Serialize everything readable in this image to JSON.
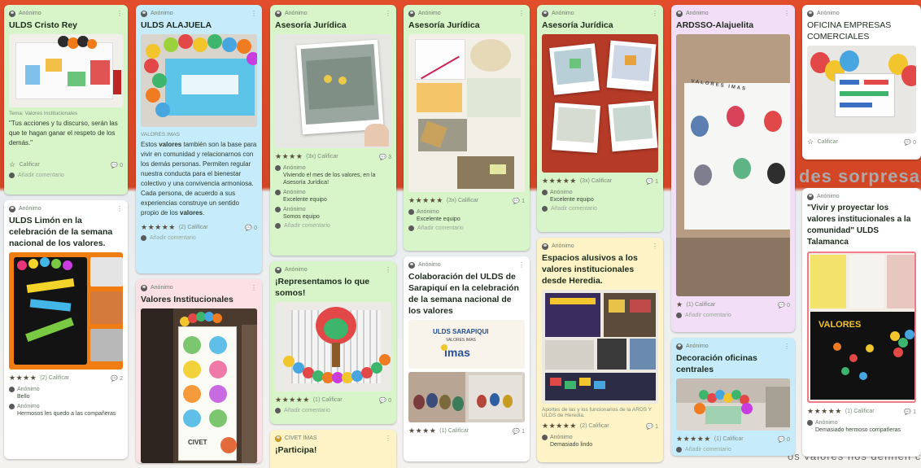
{
  "board": {
    "bg_text_1": "des sorpresas",
    "bg_text_2": "os valores nos definen com"
  },
  "author_anon": "Anónimo",
  "col1": {
    "card1": {
      "title": "ULDS Cristo Rey",
      "tema": "Tema: Valores Institucionales",
      "body": "\"Tus acciones y tu discurso, serán las que te hagan ganar el respeto de los demás.\"",
      "rate_label": "Calificar",
      "comment_count": "0",
      "add_comment": "Añadir comentario"
    },
    "card2": {
      "title": "ULDS Limón en la celebración de la semana nacional de los valores.",
      "stars": "★★★★",
      "rate_label": "(2) Calificar",
      "comment_count": "2",
      "comments": [
        {
          "text": "Bello"
        },
        {
          "text": "Hermosos les quedo a las compañeras"
        }
      ]
    }
  },
  "col2": {
    "card1": {
      "title": "ULDS ALAJUELA",
      "label": "VALORES IMAS",
      "body_pre": "Estos ",
      "body_bold": "valores",
      "body_mid": " también son la base para vivir en comunidad y relacionarnos con los demás personas. Permiten regular nuestra conducta para el bienestar colectivo y una convivencia armoniosa. Cada persona, de acuerdo a sus experiencias construye un sentido propio de los ",
      "body_bold2": "valores",
      "body_end": ".",
      "stars": "★★★★★",
      "rate_label": "(2) Calificar",
      "comment_count": "0",
      "add_comment": "Añadir comentario"
    },
    "card2": {
      "title": "Valores Institucionales",
      "poster_label": "CIVET"
    }
  },
  "col3": {
    "card1": {
      "title": "Asesoría Jurídica",
      "stars": "★★★★",
      "rate_label": "(3x) Calificar",
      "comment_count": "3",
      "comments": [
        {
          "text": "Viviendo el mes de los valores, en la Asesoría Jurídica!"
        },
        {
          "text": "Excelente equipo"
        },
        {
          "text": "Somos equipo"
        }
      ],
      "add_comment": "Añadir comentario"
    },
    "card2": {
      "title": "¡Representamos lo que somos!",
      "stars": "★★★★★",
      "rate_label": "(1) Calificar",
      "comment_count": "0",
      "add_comment": "Añadir comentario"
    },
    "card3": {
      "author": "CIVET IMAS",
      "title": "¡Participa!"
    }
  },
  "col4": {
    "card1": {
      "title": "Asesoría Jurídica",
      "stars": "★★★★★",
      "rate_label": "(3x) Calificar",
      "comment_count": "1",
      "comment": "Excelente equipo",
      "add_comment": "Añadir comentario"
    },
    "card2": {
      "title": "Colaboración del ULDS de Sarapiquí en la celebración de la semana nacional de los valores",
      "sign_line1": "ULDS SARAPIQUI",
      "sign_line2": "VALORES IMAS",
      "sign_logo": "imas",
      "stars": "★★★★",
      "rate_label": "(1) Calificar",
      "comment_count": "1"
    }
  },
  "col5": {
    "card1": {
      "title": "Asesoría Jurídica",
      "stars": "★★★★★",
      "rate_label": "(3x) Calificar",
      "comment_count": "1",
      "comment": "Excelente equipo",
      "add_comment": "Añadir comentario"
    },
    "card2": {
      "title": "Espacios alusivos a los valores institucionales desde Heredia.",
      "caption": "Aportes de las y los funcionarios de la ARDS Y ULDS de Heredia.",
      "stars": "★★★★★",
      "rate_label": "(2) Calificar",
      "comment_count": "1",
      "comment": "Demasiado lindo"
    }
  },
  "col6": {
    "card1": {
      "title": "ARDSSO-Alajuelita",
      "wall_text": "VALORES IMAS",
      "stars": "★",
      "rate_label": "(1) Calificar",
      "comment_count": "0",
      "add_comment": "Añadir comentario"
    },
    "card2": {
      "title": "Decoración oficinas centrales",
      "stars": "★★★★★",
      "rate_label": "(1) Calificar",
      "comment_count": "0",
      "add_comment": "Añadir comentario"
    }
  },
  "col7": {
    "card1": {
      "title": "OFICINA EMPRESAS COMERCIALES",
      "rate_label": "Calificar",
      "comment_count": "0"
    },
    "card2": {
      "title": "\"Vivir y proyectar los valores institucionales a la comunidad\" ULDS Talamanca",
      "board_text": "VALORES",
      "stars": "★★★★★",
      "rate_label": "(1) Calificar",
      "comment_count": "1",
      "comment": "Demasiado hermoso compañeras"
    }
  }
}
